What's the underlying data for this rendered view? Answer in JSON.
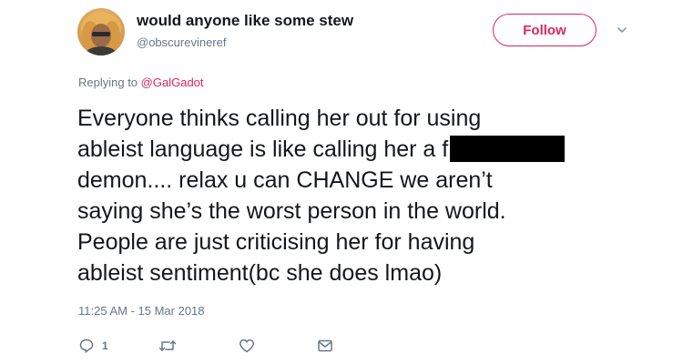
{
  "user": {
    "display_name": "would anyone like some stew",
    "handle": "@obscurevineref",
    "avatar": "profile-photo"
  },
  "header": {
    "follow_label": "Follow",
    "menu_icon": "chevron-down-icon"
  },
  "reply": {
    "prefix": "Replying to",
    "mention": "@GalGadot"
  },
  "tweet": {
    "lines": [
      "Everyone thinks calling her out for using",
      "ableist language is like calling her a f",
      "demon.... relax u can CHANGE we aren’t",
      "saying she’s the worst person in the world.",
      "People are just criticising her for having",
      "ableist sentiment(bc she does lmao)"
    ],
    "redacted": true
  },
  "meta": {
    "timestamp": "11:25 AM - 15 Mar 2018"
  },
  "actions": {
    "reply_icon": "reply-icon",
    "reply_count": "1",
    "retweet_icon": "retweet-icon",
    "like_icon": "heart-icon",
    "message_icon": "envelope-icon"
  },
  "colors": {
    "accent": "#e0245e",
    "text": "#14171a",
    "secondary": "#657786"
  }
}
